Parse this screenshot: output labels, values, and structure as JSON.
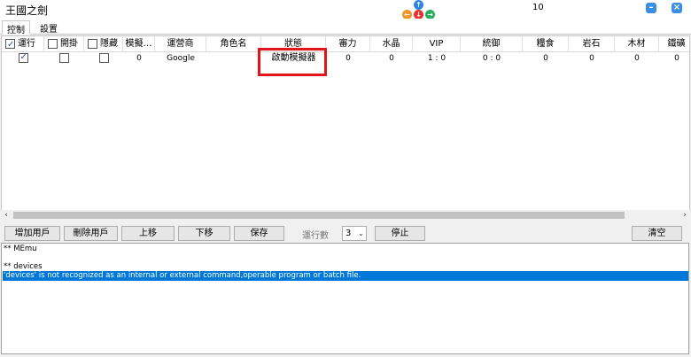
{
  "window": {
    "title": "王國之劍",
    "counter": "10"
  },
  "tabs": [
    {
      "label": "控制"
    },
    {
      "label": "設置"
    }
  ],
  "grid": {
    "columns": [
      "運行",
      "開掛",
      "隱藏",
      "模擬…",
      "運營商",
      "角色名",
      "狀態",
      "審力",
      "水晶",
      "VIP",
      "統御",
      "糧食",
      "岩石",
      "木材",
      "鐵礦"
    ],
    "rows": [
      {
        "run": true,
        "hack": false,
        "hide": false,
        "emulator": "0",
        "operator": "Google",
        "role": "",
        "status": "啟動模擬器",
        "power": "0",
        "crystal": "0",
        "vip": "1 : 0",
        "command": "0 : 0",
        "food": "0",
        "stone": "0",
        "wood": "0",
        "iron": "0"
      }
    ]
  },
  "buttons": {
    "add_user": "增加用戶",
    "delete_user": "刪除用戶",
    "move_up": "上移",
    "move_down": "下移",
    "save": "保存",
    "run_count_label": "運行數",
    "run_count_value": "3",
    "stop": "停止",
    "clear": "清空"
  },
  "log": {
    "lines": [
      "** MEmu",
      "",
      "** devices",
      "'devices' is not recognized as an internal or external command,operable program or batch file."
    ]
  },
  "colors": {
    "highlight": "#e4141b",
    "selection": "#0078d7"
  }
}
